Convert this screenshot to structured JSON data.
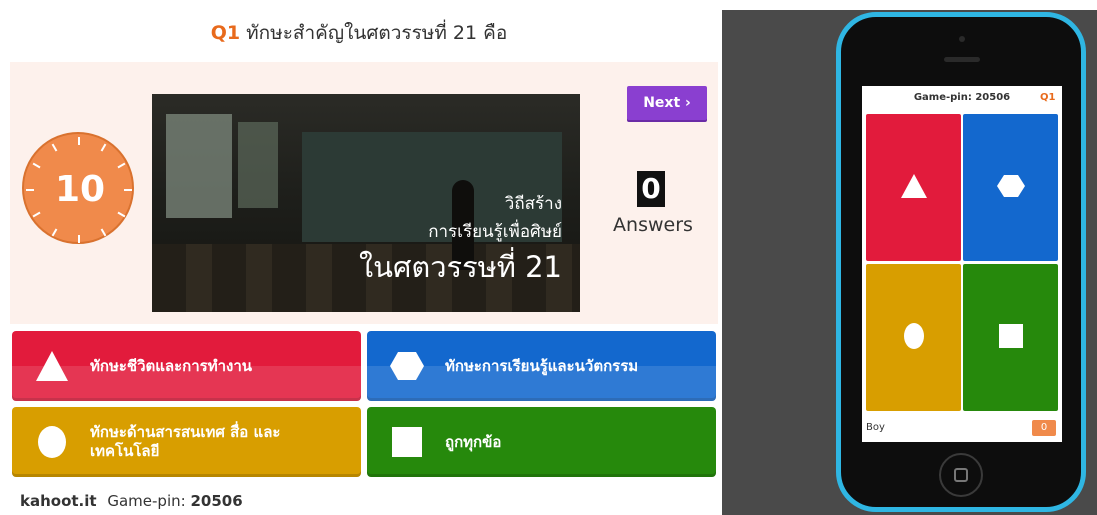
{
  "question": {
    "number": "Q1",
    "text": "ทักษะสำคัญในศตวรรษที่ 21 คือ"
  },
  "timer": {
    "value": "10"
  },
  "media": {
    "caption_line1": "วิถีสร้าง",
    "caption_line2": "การเรียนรู้เพื่อศิษย์",
    "caption_line3": "ในศตวรรษที่ 21"
  },
  "controls": {
    "next_label": "Next ›"
  },
  "answers_stat": {
    "count": "0",
    "label": "Answers"
  },
  "answers": [
    {
      "label": "ทักษะชีวิตและการทำงาน",
      "color": "#e21b3c",
      "shape": "triangle-icon"
    },
    {
      "label": "ทักษะการเรียนรู้และนวัตกรรม",
      "color": "#1368ce",
      "shape": "hexagon-icon"
    },
    {
      "label": "ทักษะด้านสารสนเทศ สื่อ และเทคโนโลยี",
      "color": "#d89e00",
      "shape": "circle-icon"
    },
    {
      "label": "ถูกทุกข้อ",
      "color": "#26890c",
      "shape": "square-icon"
    }
  ],
  "footer": {
    "brand": "kahoot.it",
    "pin_label": "Game-pin:",
    "pin_value": "20506"
  },
  "phone": {
    "header": "Game-pin: 20506",
    "question": "Q1",
    "player": "Boy",
    "score": "0"
  }
}
